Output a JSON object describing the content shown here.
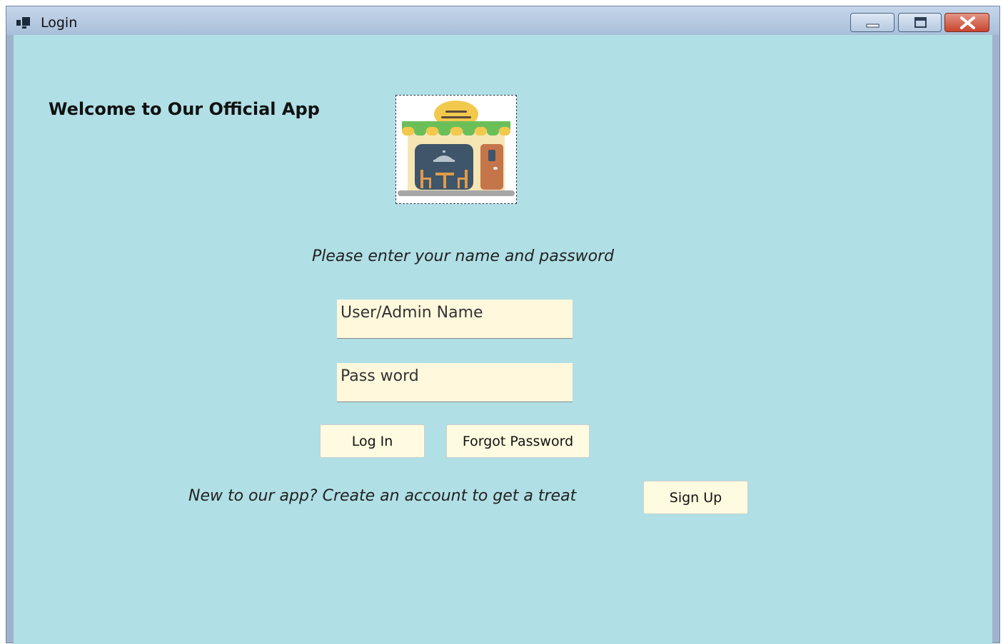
{
  "window": {
    "title": "Login",
    "icon": "app-window-icon",
    "controls": [
      "minimize-icon",
      "maximize-icon",
      "close-icon"
    ]
  },
  "main": {
    "welcome": "Welcome to Our Official App",
    "logo_icon": "restaurant-storefront-icon",
    "prompt": "Please enter your name and password",
    "username_placeholder": "User/Admin Name",
    "password_placeholder": "Pass word",
    "login_label": "Log In",
    "forgot_label": "Forgot Password",
    "signup_prompt": "New to our app? Create an account to get a treat",
    "signup_label": "Sign Up"
  },
  "colors": {
    "client_background": "#b0dfe5",
    "field_background": "#fff8dc",
    "button_background": "#fffbe0",
    "close_button": "#c7452e"
  }
}
